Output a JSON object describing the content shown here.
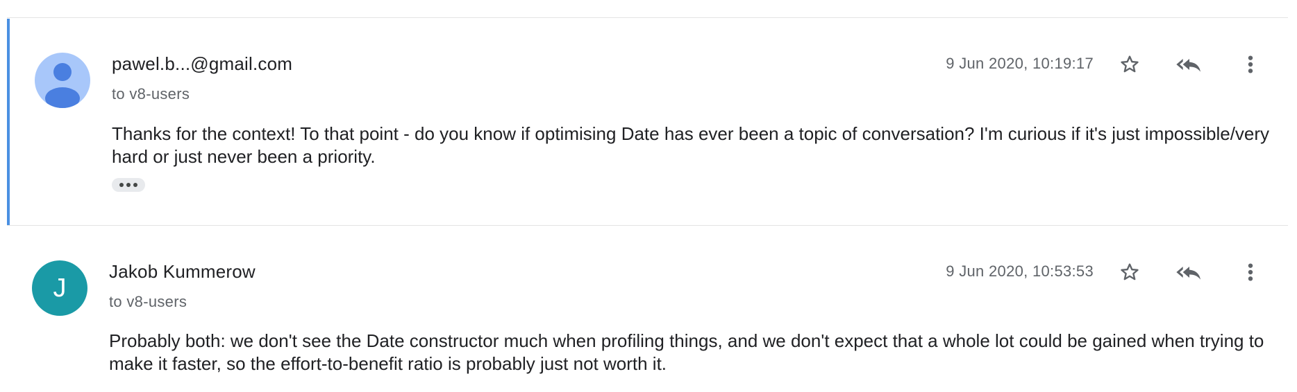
{
  "thread": {
    "messages": [
      {
        "sender": "pawel.b...@gmail.com",
        "recipient": "to v8-users",
        "timestamp": "9 Jun 2020, 10:19:17",
        "body": "Thanks for the context! To that point - do you know if optimising Date has ever been a topic of conversation? I'm curious if it's just impossible/very hard or just never been a priority.",
        "avatar": {
          "type": "person-silhouette-icon",
          "bg": "#a8c7fa",
          "fg": "#4a7fe0"
        },
        "selected": true,
        "has_quoted_text": true,
        "show_trimmed_icon": "ellipsis-icon"
      },
      {
        "sender": "Jakob Kummerow",
        "recipient": "to v8-users",
        "timestamp": "9 Jun 2020, 10:53:53",
        "body": "Probably both: we don't see the Date constructor much when profiling things, and we don't expect that a whole lot could be gained when trying to make it faster, so the effort-to-benefit ratio is probably just not worth it.",
        "avatar": {
          "type": "letter",
          "letter": "J",
          "bg": "#1a9aa6"
        },
        "selected": false
      }
    ]
  },
  "icons": {
    "star": "star-outline-icon",
    "reply_all": "reply-all-icon",
    "more": "more-vert-icon"
  },
  "colors": {
    "selected_border": "#4a90e2",
    "secondary_text": "#5f6368",
    "icon": "#5f6368"
  }
}
